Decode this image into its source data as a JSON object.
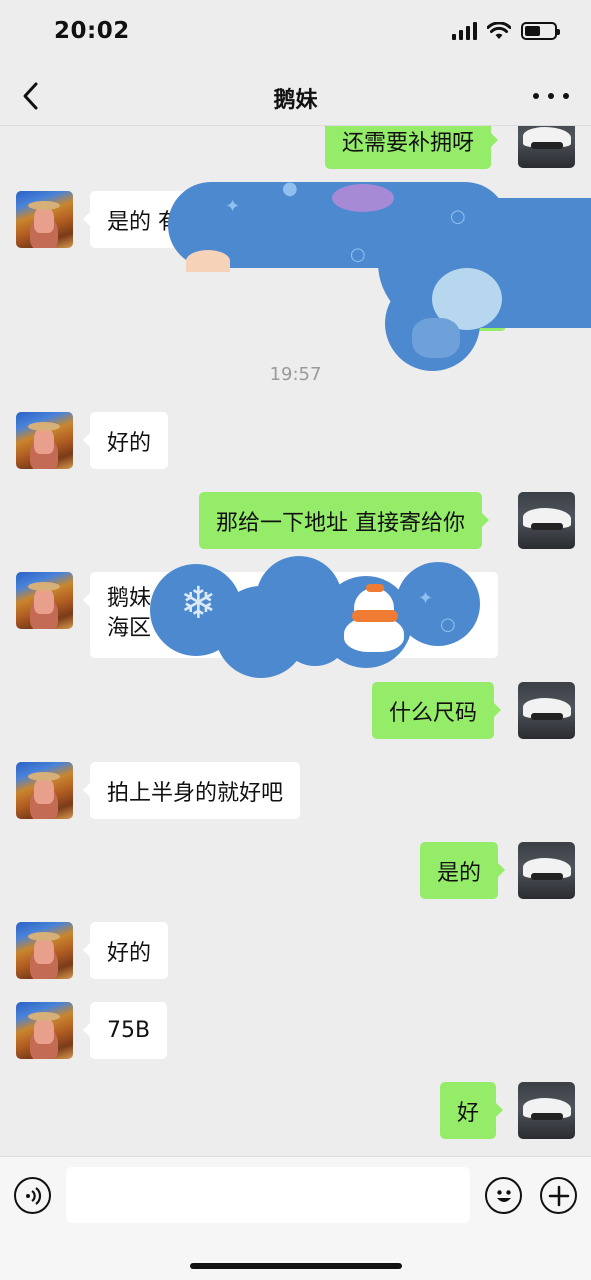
{
  "status_bar": {
    "time": "20:02"
  },
  "header": {
    "title": "鹅妹"
  },
  "messages": [
    {
      "side": "right",
      "text": "还需要补拥呀"
    },
    {
      "side": "left",
      "text": "是的 有"
    },
    {
      "side": "right",
      "text": "天"
    },
    {
      "timestamp": "19:57"
    },
    {
      "side": "left",
      "text": "好的"
    },
    {
      "side": "right",
      "text": "那给一下地址 直接寄给你"
    },
    {
      "side": "left",
      "line1": "鹅妹",
      "line2": "海区"
    },
    {
      "side": "right",
      "text": "什么尺码"
    },
    {
      "side": "left",
      "text": "拍上半身的就好吧"
    },
    {
      "side": "right",
      "text": "是的"
    },
    {
      "side": "left",
      "text": "好的"
    },
    {
      "side": "left",
      "text": "75B"
    },
    {
      "side": "right",
      "text": "好"
    }
  ],
  "input_bar": {
    "value": "",
    "placeholder": ""
  },
  "icons": {
    "back": "chevron-left-icon",
    "more": "more-dots-icon",
    "voice": "voice-icon",
    "emoji": "emoji-icon",
    "add": "plus-circle-icon"
  },
  "colors": {
    "bubble_mine": "#95ec69",
    "bubble_theirs": "#ffffff",
    "background": "#ededed",
    "sticker_blue": "#4d89cf"
  }
}
